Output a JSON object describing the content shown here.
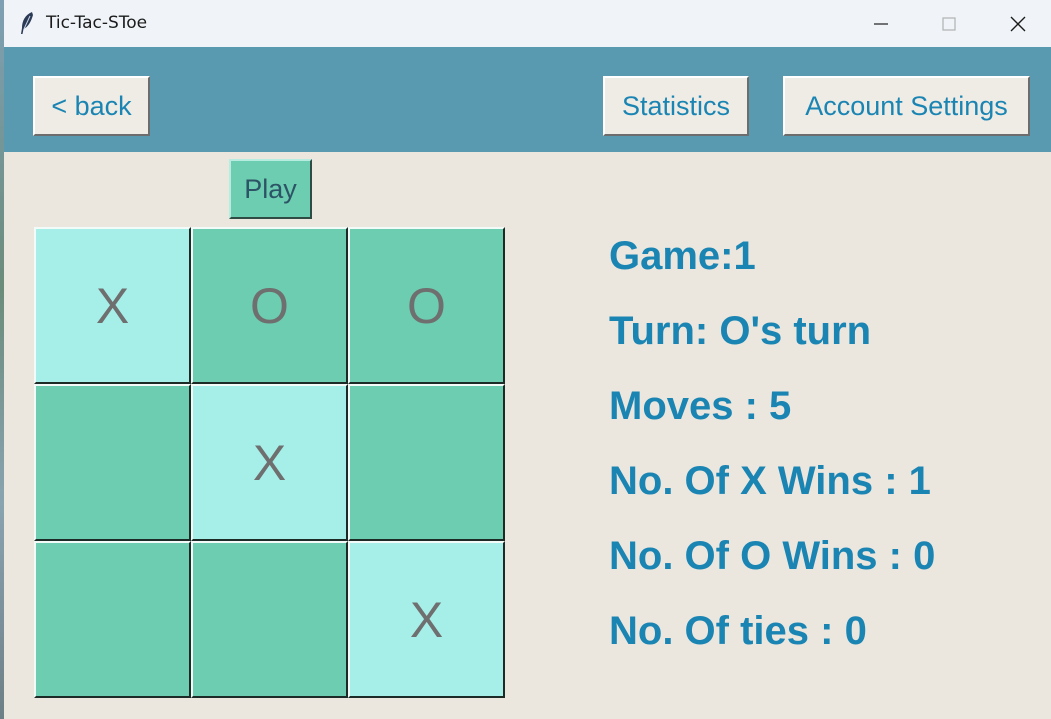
{
  "window": {
    "title": "Tic-Tac-SToe",
    "controls": [
      "minimize",
      "maximize",
      "close"
    ]
  },
  "header": {
    "back_label": "< back",
    "statistics_label": "Statistics",
    "account_settings_label": "Account Settings"
  },
  "play_label": "Play",
  "board": {
    "cells": [
      {
        "mark": "X",
        "shade": "light"
      },
      {
        "mark": "O",
        "shade": "dark"
      },
      {
        "mark": "O",
        "shade": "dark"
      },
      {
        "mark": "",
        "shade": "dark"
      },
      {
        "mark": "X",
        "shade": "light"
      },
      {
        "mark": "",
        "shade": "dark"
      },
      {
        "mark": "",
        "shade": "dark"
      },
      {
        "mark": "",
        "shade": "dark"
      },
      {
        "mark": "X",
        "shade": "light"
      }
    ]
  },
  "stats": {
    "game": "Game:1",
    "turn": "Turn: O's turn",
    "moves": "Moves : 5",
    "x_wins": "No. Of X Wins : 1",
    "o_wins": "No. Of O Wins : 0",
    "ties": "No. Of ties : 0"
  },
  "colors": {
    "header_bg": "#5a9ab1",
    "body_bg": "#ebe6de",
    "accent_text": "#1a85b3",
    "cell_light": "#a6efe9",
    "cell_dark": "#6dcdb0"
  }
}
